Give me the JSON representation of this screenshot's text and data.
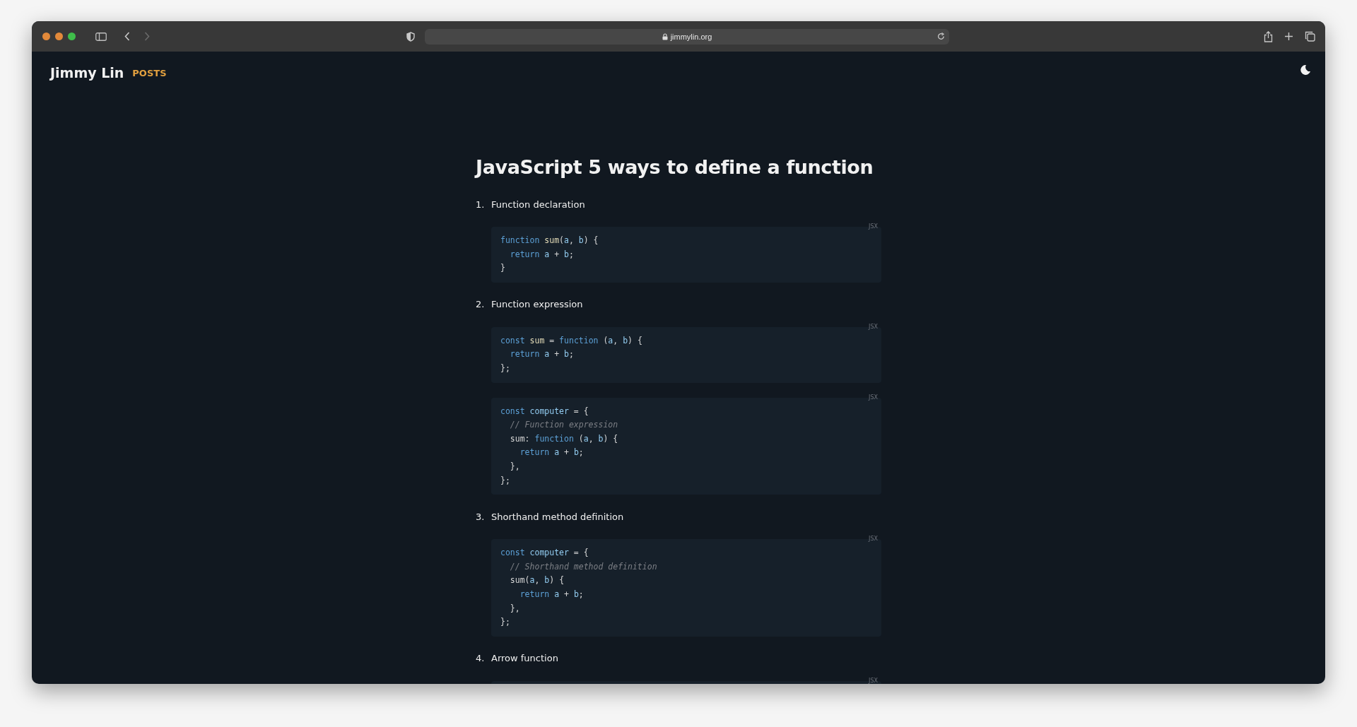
{
  "browser": {
    "url": "jimmylin.org"
  },
  "site": {
    "name": "Jimmy Lin",
    "nav": "POSTS"
  },
  "article": {
    "title": "JavaScript 5 ways to define a function",
    "sections": [
      {
        "number": "1.",
        "heading": "Function declaration",
        "blocks": [
          {
            "language": "JSX",
            "lines": [
              [
                {
                  "t": "function",
                  "kind": "keyword"
                },
                {
                  "t": " sum",
                  "kind": "name"
                },
                {
                  "t": "(",
                  "kind": "plain"
                },
                {
                  "t": "a",
                  "kind": "param"
                },
                {
                  "t": ", ",
                  "kind": "plain"
                },
                {
                  "t": "b",
                  "kind": "param"
                },
                {
                  "t": ") {",
                  "kind": "plain"
                }
              ],
              [
                {
                  "t": "  return",
                  "kind": "keyword"
                },
                {
                  "t": " a",
                  "kind": "param"
                },
                {
                  "t": " + ",
                  "kind": "plain"
                },
                {
                  "t": "b",
                  "kind": "param"
                },
                {
                  "t": ";",
                  "kind": "plain"
                }
              ],
              [
                {
                  "t": "}",
                  "kind": "plain"
                }
              ]
            ]
          }
        ]
      },
      {
        "number": "2.",
        "heading": "Function expression",
        "blocks": [
          {
            "language": "JSX",
            "lines": [
              [
                {
                  "t": "const",
                  "kind": "keyword"
                },
                {
                  "t": " sum",
                  "kind": "name"
                },
                {
                  "t": " = ",
                  "kind": "plain"
                },
                {
                  "t": "function",
                  "kind": "keyword"
                },
                {
                  "t": " (",
                  "kind": "plain"
                },
                {
                  "t": "a",
                  "kind": "param"
                },
                {
                  "t": ", ",
                  "kind": "plain"
                },
                {
                  "t": "b",
                  "kind": "param"
                },
                {
                  "t": ") {",
                  "kind": "plain"
                }
              ],
              [
                {
                  "t": "  return",
                  "kind": "keyword"
                },
                {
                  "t": " a",
                  "kind": "param"
                },
                {
                  "t": " + ",
                  "kind": "plain"
                },
                {
                  "t": "b",
                  "kind": "param"
                },
                {
                  "t": ";",
                  "kind": "plain"
                }
              ],
              [
                {
                  "t": "};",
                  "kind": "plain"
                }
              ]
            ]
          },
          {
            "language": "JSX",
            "lines": [
              [
                {
                  "t": "const",
                  "kind": "keyword"
                },
                {
                  "t": " computer",
                  "kind": "param"
                },
                {
                  "t": " = {",
                  "kind": "plain"
                }
              ],
              [
                {
                  "t": "  // Function expression",
                  "kind": "comment"
                }
              ],
              [
                {
                  "t": "  sum: ",
                  "kind": "plain"
                },
                {
                  "t": "function",
                  "kind": "keyword"
                },
                {
                  "t": " (",
                  "kind": "plain"
                },
                {
                  "t": "a",
                  "kind": "param"
                },
                {
                  "t": ", ",
                  "kind": "plain"
                },
                {
                  "t": "b",
                  "kind": "param"
                },
                {
                  "t": ") {",
                  "kind": "plain"
                }
              ],
              [
                {
                  "t": "    return",
                  "kind": "keyword"
                },
                {
                  "t": " a",
                  "kind": "param"
                },
                {
                  "t": " + ",
                  "kind": "plain"
                },
                {
                  "t": "b",
                  "kind": "param"
                },
                {
                  "t": ";",
                  "kind": "plain"
                }
              ],
              [
                {
                  "t": "  },",
                  "kind": "plain"
                }
              ],
              [
                {
                  "t": "};",
                  "kind": "plain"
                }
              ]
            ]
          }
        ]
      },
      {
        "number": "3.",
        "heading": "Shorthand method definition",
        "blocks": [
          {
            "language": "JSX",
            "lines": [
              [
                {
                  "t": "const",
                  "kind": "keyword"
                },
                {
                  "t": " computer",
                  "kind": "param"
                },
                {
                  "t": " = {",
                  "kind": "plain"
                }
              ],
              [
                {
                  "t": "  // Shorthand method definition",
                  "kind": "comment"
                }
              ],
              [
                {
                  "t": "  sum(",
                  "kind": "plain"
                },
                {
                  "t": "a",
                  "kind": "param"
                },
                {
                  "t": ", ",
                  "kind": "plain"
                },
                {
                  "t": "b",
                  "kind": "param"
                },
                {
                  "t": ") {",
                  "kind": "plain"
                }
              ],
              [
                {
                  "t": "    return",
                  "kind": "keyword"
                },
                {
                  "t": " a",
                  "kind": "param"
                },
                {
                  "t": " + ",
                  "kind": "plain"
                },
                {
                  "t": "b",
                  "kind": "param"
                },
                {
                  "t": ";",
                  "kind": "plain"
                }
              ],
              [
                {
                  "t": "  },",
                  "kind": "plain"
                }
              ],
              [
                {
                  "t": "};",
                  "kind": "plain"
                }
              ]
            ]
          }
        ]
      },
      {
        "number": "4.",
        "heading": "Arrow function",
        "blocks": [
          {
            "language": "JSX"
          }
        ]
      }
    ]
  }
}
